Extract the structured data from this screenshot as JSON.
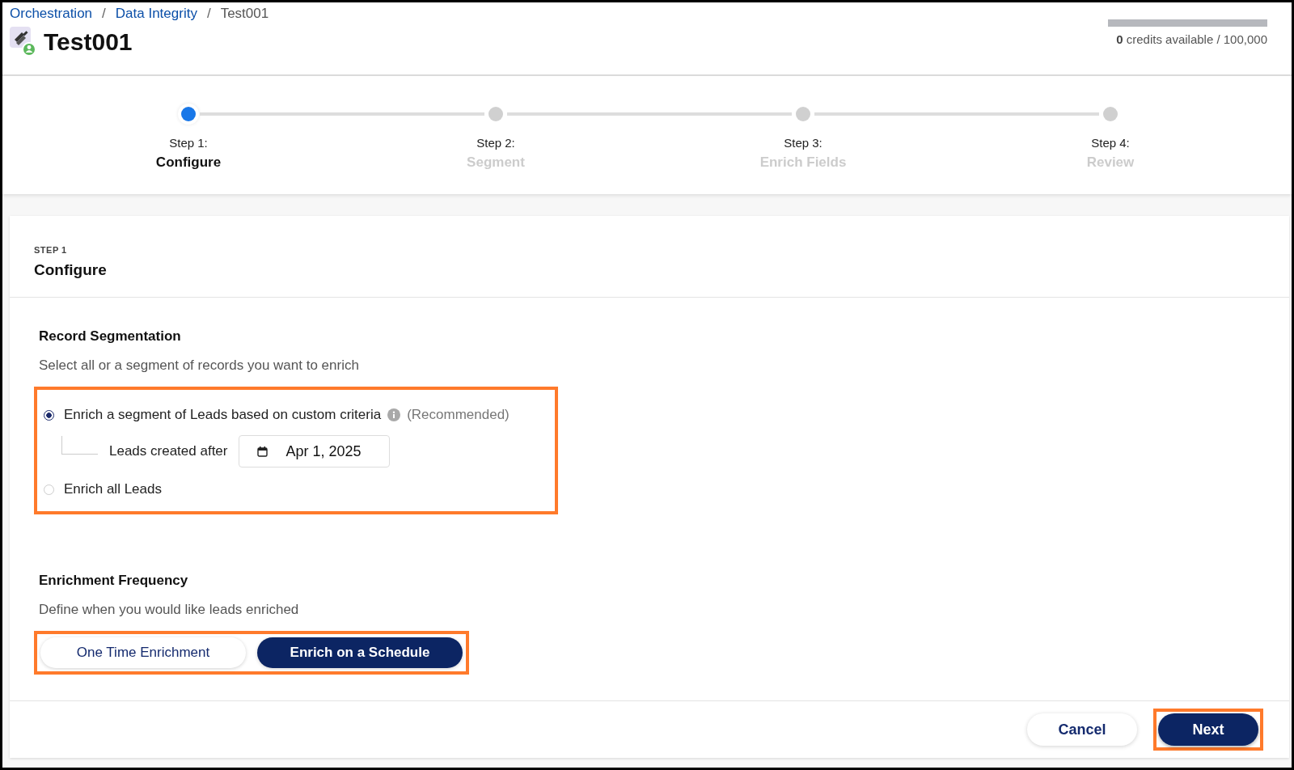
{
  "breadcrumbs": [
    {
      "label": "Orchestration",
      "kind": "link"
    },
    {
      "label": "/",
      "kind": "separator"
    },
    {
      "label": "Data Integrity",
      "kind": "link"
    },
    {
      "label": "/",
      "kind": "separator"
    },
    {
      "label": "Test001",
      "kind": "current"
    }
  ],
  "title": "Test001",
  "credits": {
    "count": "0",
    "text": "credits available / 100,000",
    "level": 0
  },
  "steps": [
    {
      "number": "Step 1:",
      "name": "Configure",
      "selected": true
    },
    {
      "number": "Step 2:",
      "name": "Segment",
      "selected": false
    },
    {
      "number": "Step 3:",
      "name": "Enrich Fields",
      "selected": false
    },
    {
      "number": "Step 4:",
      "name": "Review",
      "selected": false
    }
  ],
  "panel": {
    "eyebrow": "STEP 1",
    "heading": "Configure"
  },
  "record_segmentation": {
    "title": "Record Segmentation",
    "description": "Select all or a segment of records you want to enrich",
    "highlighted": true,
    "options": [
      {
        "label": "Enrich a segment of Leads based on custom criteria",
        "note": "(Recommended)",
        "selected": true,
        "sub": {
          "label": "Leads created after",
          "date": "Apr 1, 2025"
        }
      },
      {
        "label": "Enrich all Leads",
        "selected": false
      }
    ]
  },
  "enrichment_frequency": {
    "title": "Enrichment Frequency",
    "description": "Define when you would like leads enriched",
    "highlighted": true,
    "options": [
      {
        "label": "One Time Enrichment",
        "selected": false
      },
      {
        "label": "Enrich on a Schedule",
        "selected": true
      }
    ]
  },
  "footer": {
    "buttons": [
      {
        "label": "Cancel",
        "kind": "secondary",
        "highlighted": false
      },
      {
        "label": "Next",
        "kind": "primary",
        "highlighted": true
      }
    ]
  }
}
